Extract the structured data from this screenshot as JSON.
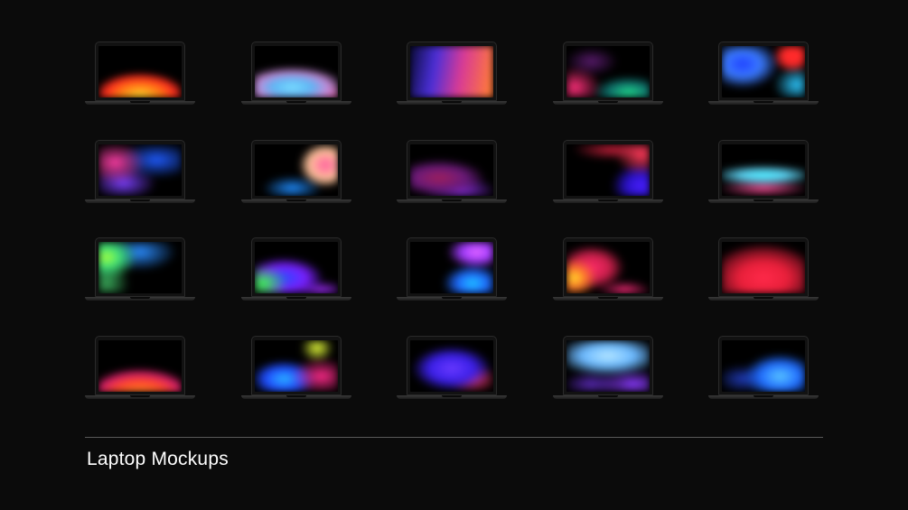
{
  "title": "Laptop Mockups",
  "mockups": [
    {
      "name": "laptop-fire-wave",
      "bg": "radial-gradient(ellipse 70% 55% at 50% 95%, #ffd12a 0%, #ff7a14 35%, #ff2b1f 60%, transparent 80%)"
    },
    {
      "name": "laptop-cyan-pink-wave",
      "bg": "radial-gradient(ellipse 80% 50% at 45% 80%, #7fe0ff 0%, #5bb6f5 30%, #c78ad8 55%, transparent 80%), radial-gradient(ellipse 40% 30% at 90% 95%, #ff5ea8 0%, transparent 80%)"
    },
    {
      "name": "laptop-purple-orange",
      "bg": "linear-gradient(100deg, #0a0b3a 0%, #4a2fd8 30%, #d83a96 60%, #ff7a3a 95%)"
    },
    {
      "name": "laptop-magenta-teal",
      "bg": "radial-gradient(ellipse 40% 50% at 10% 80%, #ff2f7a 0%, transparent 80%), radial-gradient(ellipse 55% 40% at 75% 90%, #1fd98a 0%, #0f6e6a 45%, transparent 80%), radial-gradient(ellipse 40% 35% at 30% 30%, #5a1b6e 0%, transparent 80%)"
    },
    {
      "name": "laptop-blue-red",
      "bg": "radial-gradient(ellipse 30% 40% at 85% 20%, #ff2a2a 0%, #ff2a2a 40%, transparent 80%), radial-gradient(ellipse 55% 60% at 25% 35%, #1e3fff 0%, #3b7bff 40%, transparent 80%), radial-gradient(ellipse 35% 45% at 90% 75%, #2cc8ff 0%, transparent 80%)"
    },
    {
      "name": "laptop-pink-blue-diagonal",
      "bg": "radial-gradient(ellipse 45% 50% at 20% 35%, #ff3fa8 0%, transparent 80%), radial-gradient(ellipse 60% 45% at 70% 30%, #1f5bff 0%, transparent 80%), radial-gradient(ellipse 50% 40% at 30% 75%, #7a3fff 0%, transparent 80%)"
    },
    {
      "name": "laptop-blue-peach",
      "bg": "radial-gradient(ellipse 40% 55% at 85% 40%, #ff5ea0 0%, #ffc49a 50%, transparent 80%), radial-gradient(ellipse 45% 30% at 45% 85%, #1e8cff 0%, transparent 80%)"
    },
    {
      "name": "laptop-maroon-violet",
      "bg": "radial-gradient(ellipse 70% 45% at 35% 65%, #a01f5a 0%, #6a1a7a 45%, transparent 80%), radial-gradient(ellipse 55% 35% at 60% 90%, #8a2fe8 0%, transparent 80%)"
    },
    {
      "name": "laptop-red-indigo-corner",
      "bg": "radial-gradient(ellipse 40% 50% at 90% 20%, #ff3a5a 0%, transparent 80%), radial-gradient(ellipse 45% 55% at 90% 80%, #4a1fff 0%, #2a12c8 40%, transparent 80%), radial-gradient(ellipse 60% 25% at 55% 10%, #c81f3a 0%, transparent 80%)"
    },
    {
      "name": "laptop-cyan-wave",
      "bg": "radial-gradient(ellipse 80% 25% at 50% 60%, #4cf0ff 0%, #5ad0f0 35%, transparent 80%), radial-gradient(ellipse 70% 20% at 50% 85%, #ff4f9a 0%, transparent 80%)"
    },
    {
      "name": "laptop-lime-blue",
      "bg": "radial-gradient(ellipse 45% 55% at 10% 30%, #aaff3a 0%, #3ee07a 35%, transparent 80%), radial-gradient(ellipse 55% 45% at 50% 20%, #2a8cff 0%, transparent 80%), radial-gradient(ellipse 35% 45% at 10% 80%, #3aaa5a 0%, transparent 80%)"
    },
    {
      "name": "laptop-green-violet",
      "bg": "radial-gradient(ellipse 40% 45% at 10% 80%, #3aff4a 0%, transparent 75%), radial-gradient(ellipse 60% 50% at 35% 70%, #2a4aff 0%, #7a1fff 45%, transparent 80%), radial-gradient(ellipse 40% 25% at 80% 95%, #a02aff 0%, transparent 80%)"
    },
    {
      "name": "laptop-violet-blue-right",
      "bg": "radial-gradient(ellipse 45% 40% at 80% 20%, #e86aff 0%, #a03aff 40%, transparent 80%), radial-gradient(ellipse 45% 45% at 75% 80%, #1ec8ff 0%, #1f6aff 40%, transparent 80%)"
    },
    {
      "name": "laptop-yellow-red-triangle",
      "bg": "radial-gradient(ellipse 35% 50% at 10% 70%, #ffe02a 0%, #ff7a2a 35%, transparent 75%), radial-gradient(ellipse 50% 55% at 30% 50%, #ff2a6a 0%, #c81f4a 45%, transparent 80%), radial-gradient(ellipse 40% 25% at 70% 95%, #ff2a7a 0%, transparent 80%)"
    },
    {
      "name": "laptop-red-glow",
      "bg": "radial-gradient(ellipse 75% 75% at 50% 70%, #ff2a4a 0%, #e81f3a 40%, #7a1020 70%, transparent 90%)"
    },
    {
      "name": "laptop-orange-arc",
      "bg": "radial-gradient(ellipse 75% 60% at 50% 105%, #ff8a1f 0%, #ff4a2a 40%, #d81f6a 65%, transparent 85%)"
    },
    {
      "name": "laptop-yellow-pink-blue",
      "bg": "radial-gradient(ellipse 25% 35% at 75% 15%, #e8ff3a 0%, transparent 80%), radial-gradient(ellipse 45% 45% at 80% 70%, #ff2a8a 0%, transparent 80%), radial-gradient(ellipse 50% 45% at 35% 75%, #2ab8ff 0%, #1f4aff 45%, transparent 80%)"
    },
    {
      "name": "laptop-indigo-blob",
      "bg": "radial-gradient(ellipse 60% 55% at 50% 55%, #6a3aff 0%, #3a1fe8 45%, transparent 80%), radial-gradient(ellipse 40% 35% at 75% 75%, #ff3a6a 0%, transparent 80%)"
    },
    {
      "name": "laptop-lightblue-violet",
      "bg": "radial-gradient(ellipse 80% 50% at 50% 30%, #b8e8ff 0%, #6ab8ff 40%, transparent 80%), radial-gradient(ellipse 55% 35% at 80% 85%, #8a3aff 0%, transparent 80%), radial-gradient(ellipse 45% 30% at 30% 85%, #5a2ab8 0%, transparent 80%)"
    },
    {
      "name": "laptop-deep-blue",
      "bg": "radial-gradient(ellipse 55% 55% at 70% 70%, #5ac8ff 0%, #1f6aff 45%, transparent 80%), radial-gradient(ellipse 40% 35% at 25% 75%, #1f3ab8 0%, transparent 80%)"
    }
  ]
}
